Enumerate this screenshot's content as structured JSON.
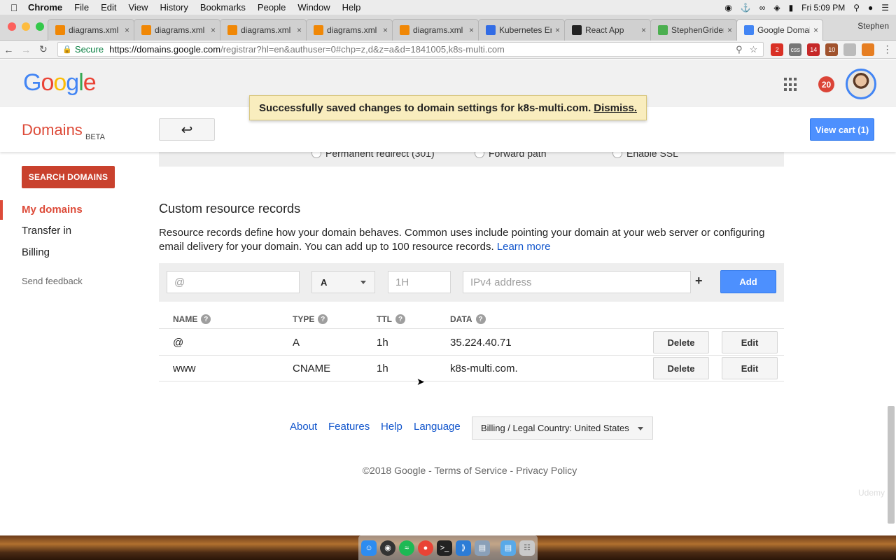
{
  "menubar": {
    "items": [
      "Chrome",
      "File",
      "Edit",
      "View",
      "History",
      "Bookmarks",
      "People",
      "Window",
      "Help"
    ],
    "clock": "Fri 5:09 PM"
  },
  "tabs": [
    {
      "title": "diagrams.xml",
      "favicon": "drawio-icon",
      "color": "#f08705"
    },
    {
      "title": "diagrams.xml",
      "favicon": "drawio-icon",
      "color": "#f08705"
    },
    {
      "title": "diagrams.xml",
      "favicon": "drawio-icon",
      "color": "#f08705"
    },
    {
      "title": "diagrams.xml",
      "favicon": "drawio-icon",
      "color": "#f08705"
    },
    {
      "title": "diagrams.xml",
      "favicon": "drawio-icon",
      "color": "#f08705"
    },
    {
      "title": "Kubernetes En",
      "favicon": "kubernetes-icon",
      "color": "#326ce5"
    },
    {
      "title": "React App",
      "favicon": "react-icon",
      "color": "#222222"
    },
    {
      "title": "StephenGrider/",
      "favicon": "github-icon",
      "color": "#4caf50"
    },
    {
      "title": "Google Domain",
      "favicon": "google-domains-icon",
      "color": "#4285f4",
      "active": true
    }
  ],
  "profile_name": "Stephen",
  "address": {
    "secure_label": "Secure",
    "url_host": "https://domains.google.com",
    "url_path": "/registrar?hl=en&authuser=0#chp=z,d&z=a&d=1841005,k8s-multi.com"
  },
  "extensions": [
    {
      "label": "2",
      "color": "#d93025"
    },
    {
      "label": "css",
      "color": "#777777"
    },
    {
      "label": "14",
      "color": "#c62828"
    },
    {
      "label": "10",
      "color": "#a0522d"
    },
    {
      "label": "",
      "color": "#bbbbbb"
    },
    {
      "label": "",
      "color": "#e67e22"
    }
  ],
  "google": {
    "logo": [
      "G",
      "o",
      "o",
      "g",
      "l",
      "e"
    ],
    "logo_colors": [
      "#4285f4",
      "#ea4335",
      "#fbbc05",
      "#4285f4",
      "#34a853",
      "#ea4335"
    ],
    "notifications": "20"
  },
  "toast": {
    "message": "Successfully saved changes to domain settings for k8s-multi.com.",
    "dismiss": "Dismiss."
  },
  "domains_header": {
    "brand": "Domains",
    "beta": "BETA",
    "back": "↩",
    "cart": "View cart (1)"
  },
  "sidebar": {
    "search_button": "SEARCH DOMAINS",
    "items": [
      "My domains",
      "Transfer in",
      "Billing"
    ],
    "feedback": "Send feedback"
  },
  "forwarding_options": [
    "Permanent redirect (301)",
    "Forward path",
    "Enable SSL"
  ],
  "records": {
    "title": "Custom resource records",
    "description": "Resource records define how your domain behaves. Common uses include pointing your domain at your web server or configuring email delivery for your domain. You can add up to 100 resource records.",
    "learn_more": "Learn more",
    "new_record": {
      "name_placeholder": "@",
      "type": "A",
      "ttl_placeholder": "1H",
      "data_placeholder": "IPv4 address",
      "plus": "+",
      "add": "Add"
    },
    "columns": [
      "NAME",
      "TYPE",
      "TTL",
      "DATA"
    ],
    "rows": [
      {
        "name": "@",
        "type": "A",
        "ttl": "1h",
        "data": "35.224.40.71"
      },
      {
        "name": "www",
        "type": "CNAME",
        "ttl": "1h",
        "data": "k8s-multi.com."
      }
    ],
    "delete_label": "Delete",
    "edit_label": "Edit"
  },
  "footer": {
    "links": [
      "About",
      "Features",
      "Help",
      "Language"
    ],
    "country": "Billing / Legal Country: United States",
    "copyright": "©2018 Google - Terms of Service - Privacy Policy"
  },
  "watermark": "Udemy"
}
